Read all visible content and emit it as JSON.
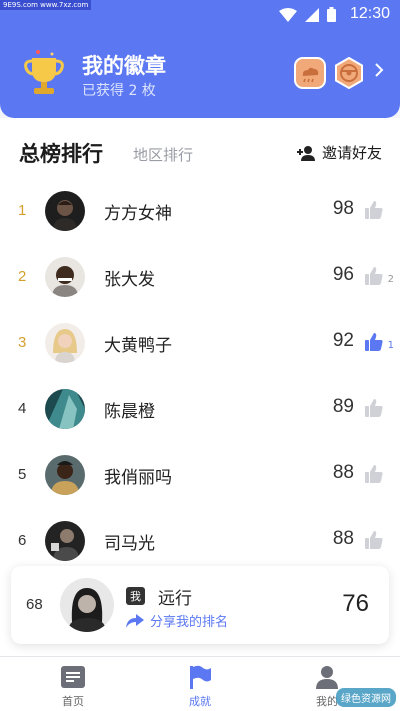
{
  "watermark": {
    "top": "9E9S.com www.7xz.com",
    "bottom": "绿色资源网"
  },
  "status_bar": {
    "time": "12:30"
  },
  "badges": {
    "title": "我的徽章",
    "subtitle": "已获得 2 枚"
  },
  "tabs": {
    "active": "总榜排行",
    "inactive": "地区排行",
    "invite": "邀请好友"
  },
  "leaderboard": [
    {
      "rank": "1",
      "name": "方方女神",
      "score": "98",
      "likes": "",
      "liked": false,
      "gold": true
    },
    {
      "rank": "2",
      "name": "张大发",
      "score": "96",
      "likes": "2",
      "liked": false,
      "gold": true
    },
    {
      "rank": "3",
      "name": "大黄鸭子",
      "score": "92",
      "likes": "1",
      "liked": true,
      "gold": true
    },
    {
      "rank": "4",
      "name": "陈晨橙",
      "score": "89",
      "likes": "",
      "liked": false,
      "gold": false
    },
    {
      "rank": "5",
      "name": "我俏丽吗",
      "score": "88",
      "likes": "",
      "liked": false,
      "gold": false
    },
    {
      "rank": "6",
      "name": "司马光",
      "score": "88",
      "likes": "",
      "liked": false,
      "gold": false
    }
  ],
  "my_entry": {
    "rank": "68",
    "tag": "我",
    "name": "远行",
    "share": "分享我的排名",
    "score": "76"
  },
  "nav": {
    "home": "首页",
    "achievements": "成就",
    "mine": "我的"
  },
  "colors": {
    "accent": "#5b78f2",
    "gold": "#d4a12f"
  }
}
